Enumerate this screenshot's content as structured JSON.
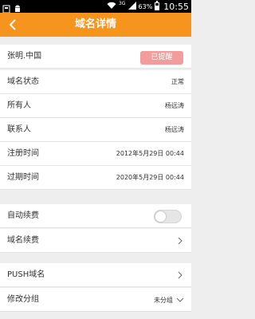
{
  "status_bar": {
    "network": "3G",
    "battery_percent": "63%",
    "battery_level": 0.63,
    "time": "10:55"
  },
  "nav": {
    "title": "域名详情",
    "back_icon": "chevron-left-icon"
  },
  "domain": {
    "name": "张明.中国",
    "badge": "已提醒",
    "badge_color": "#f29c9c"
  },
  "details": [
    {
      "label": "域名状态",
      "value": "正常"
    },
    {
      "label": "所有人",
      "value": "杨远涛"
    },
    {
      "label": "联系人",
      "value": "杨远涛"
    },
    {
      "label": "注册时间",
      "value": "2012年5月29日 00:44"
    },
    {
      "label": "过期时间",
      "value": "2020年5月29日 00:44"
    }
  ],
  "settings": {
    "auto_renew_label": "自动续费",
    "auto_renew_on": false,
    "renew_label": "域名续费",
    "push_label": "PUSH域名",
    "group_label": "修改分组",
    "group_value": "未分组"
  },
  "colors": {
    "accent": "#f7941d",
    "background": "#eeeeee"
  }
}
